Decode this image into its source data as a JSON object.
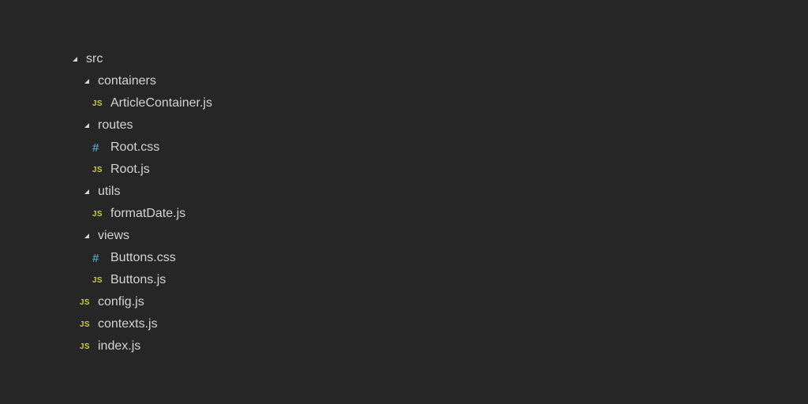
{
  "explorer": {
    "root": {
      "label": "src"
    },
    "containers": {
      "label": "containers",
      "files": [
        {
          "label": "ArticleContainer.js",
          "icon": "js-file-icon",
          "icon_text": "JS"
        }
      ]
    },
    "routes": {
      "label": "routes",
      "files": [
        {
          "label": "Root.css",
          "icon": "css-file-icon",
          "icon_text": "#"
        },
        {
          "label": "Root.js",
          "icon": "js-file-icon",
          "icon_text": "JS"
        }
      ]
    },
    "utils": {
      "label": "utils",
      "files": [
        {
          "label": "formatDate.js",
          "icon": "js-file-icon",
          "icon_text": "JS"
        }
      ]
    },
    "views": {
      "label": "views",
      "files": [
        {
          "label": "Buttons.css",
          "icon": "css-file-icon",
          "icon_text": "#"
        },
        {
          "label": "Buttons.js",
          "icon": "js-file-icon",
          "icon_text": "JS"
        }
      ]
    },
    "root_files": [
      {
        "label": "config.js",
        "icon": "js-file-icon",
        "icon_text": "JS"
      },
      {
        "label": "contexts.js",
        "icon": "js-file-icon",
        "icon_text": "JS"
      },
      {
        "label": "index.js",
        "icon": "js-file-icon",
        "icon_text": "JS"
      }
    ]
  },
  "colors": {
    "background": "#262626",
    "text": "#d4d4d4",
    "js_icon": "#cbcb41",
    "css_icon": "#519aba",
    "twisty": "#d4d4d4"
  }
}
